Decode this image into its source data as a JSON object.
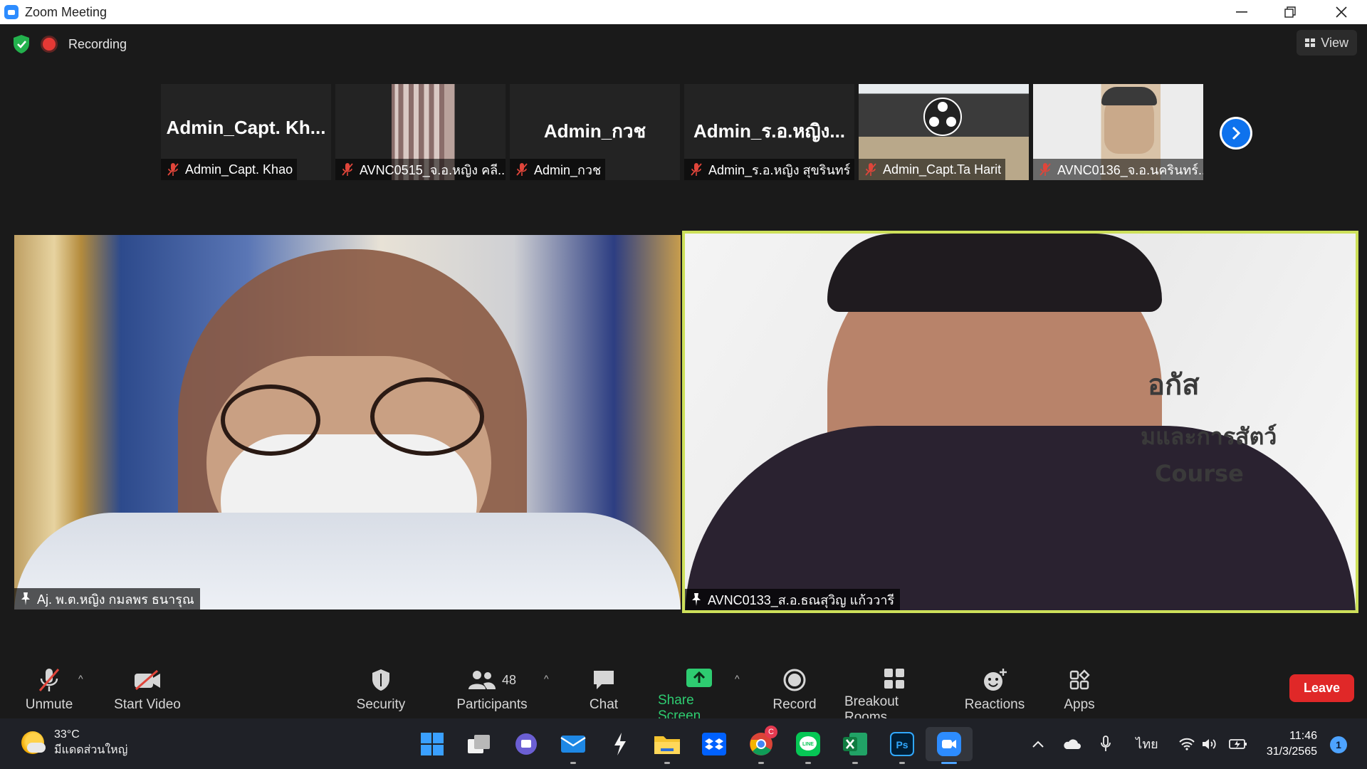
{
  "window": {
    "title": "Zoom Meeting"
  },
  "topbar": {
    "recording_label": "Recording",
    "view_label": "View"
  },
  "thumbnails": [
    {
      "big_name": "Admin_Capt. Kh...",
      "label": "Admin_Capt. Khao",
      "has_video": false
    },
    {
      "big_name": "",
      "label": "AVNC0515_จ.อ.หญิง คลี...",
      "has_video": true
    },
    {
      "big_name": "Admin_กวช",
      "label": "Admin_กวช",
      "has_video": false
    },
    {
      "big_name": "Admin_ร.อ.หญิง...",
      "label": "Admin_ร.อ.หญิง สุขรินทร์",
      "has_video": false
    },
    {
      "big_name": "",
      "label": "Admin_Capt.Ta Harit",
      "has_video": true
    },
    {
      "big_name": "",
      "label": "AVNC0136_จ.อ.นครินทร์...",
      "has_video": true
    }
  ],
  "tiles": {
    "left_label": "Aj. พ.ต.หญิง กมลพร ธนารุณ",
    "right_label": "AVNC0133_ส.อ.ธณสุวิญ แก้ววารี"
  },
  "toolbar": {
    "unmute": "Unmute",
    "start_video": "Start Video",
    "security": "Security",
    "participants": "Participants",
    "participants_count": "48",
    "chat": "Chat",
    "share_screen": "Share Screen",
    "record": "Record",
    "breakout_rooms": "Breakout Rooms",
    "reactions": "Reactions",
    "apps": "Apps",
    "leave": "Leave"
  },
  "taskbar": {
    "weather_temp": "33°C",
    "weather_desc": "มีแดดส่วนใหญ่",
    "language": "ไทย",
    "time": "11:46",
    "date": "31/3/2565",
    "notification_count": "1",
    "chrome_badge": "C"
  },
  "colors": {
    "active_speaker_border": "#cde05a",
    "share_green": "#2ecc71",
    "leave_red": "#e02828",
    "recording_red": "#e53935",
    "muted_red": "#e0453a"
  }
}
